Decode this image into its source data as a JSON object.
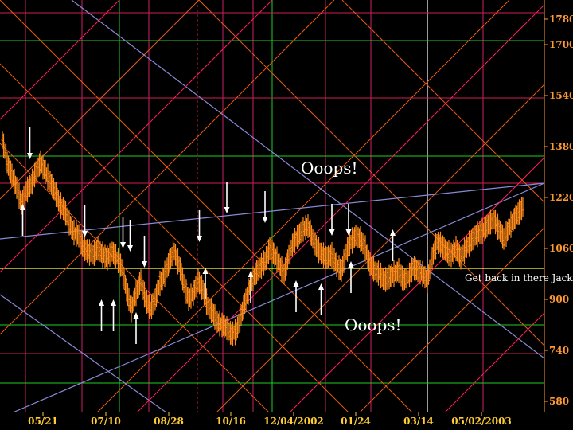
{
  "chart_data": {
    "type": "bar",
    "subtype": "ohlc-with-gann-square-overlay",
    "title": "",
    "xlabel": "",
    "ylabel": "",
    "ylim": [
      520,
      1800
    ],
    "grid": true,
    "y_ticks": [
      "1780",
      "1700",
      "1540",
      "1380",
      "1220",
      "1060",
      "900",
      "740",
      "580"
    ],
    "x_ticks": [
      "05/21",
      "07/10",
      "08/28",
      "10/16",
      "12/04/2002",
      "01/24",
      "03/14",
      "05/02/2003"
    ],
    "annotations": [
      {
        "text": "Ooops!",
        "near": "upper-center",
        "size": "large"
      },
      {
        "text": "Ooops!",
        "near": "lower-center",
        "size": "large"
      },
      {
        "text": "Get back in there Jack!",
        "near": "right",
        "size": "small"
      }
    ],
    "colors": {
      "background": "#000000",
      "bars": "#ff8c1a",
      "axis_labels": "#ff9933",
      "date_labels": "#ffcc33",
      "vertical_grid_magenta": "#cc1f66",
      "vertical_grid_green": "#22cc22",
      "vertical_grid_white": "#ffffff",
      "horizontal_grid_magenta": "#cc1f55",
      "horizontal_grid_green": "#22cc22",
      "horizontal_yellow": "#ffff33",
      "diagonal_orange": "#e65c1a",
      "diagonal_blue": "#8a8ad6",
      "diagonal_red": "#ff2255",
      "arrows": "#ffffff"
    },
    "price_path": [
      [
        0,
        1400
      ],
      [
        4,
        1330
      ],
      [
        8,
        1290
      ],
      [
        12,
        1250
      ],
      [
        16,
        1200
      ],
      [
        20,
        1240
      ],
      [
        24,
        1260
      ],
      [
        28,
        1300
      ],
      [
        32,
        1330
      ],
      [
        36,
        1300
      ],
      [
        40,
        1270
      ],
      [
        44,
        1240
      ],
      [
        48,
        1200
      ],
      [
        52,
        1180
      ],
      [
        56,
        1140
      ],
      [
        60,
        1110
      ],
      [
        64,
        1100
      ],
      [
        68,
        1060
      ],
      [
        72,
        1050
      ],
      [
        76,
        1040
      ],
      [
        80,
        1060
      ],
      [
        84,
        1040
      ],
      [
        88,
        1030
      ],
      [
        92,
        1050
      ],
      [
        96,
        1030
      ],
      [
        100,
        1000
      ],
      [
        104,
        930
      ],
      [
        108,
        870
      ],
      [
        112,
        920
      ],
      [
        116,
        960
      ],
      [
        120,
        900
      ],
      [
        124,
        870
      ],
      [
        128,
        900
      ],
      [
        132,
        950
      ],
      [
        136,
        980
      ],
      [
        140,
        1020
      ],
      [
        144,
        1050
      ],
      [
        148,
        1010
      ],
      [
        152,
        950
      ],
      [
        156,
        900
      ],
      [
        160,
        920
      ],
      [
        164,
        960
      ],
      [
        168,
        930
      ],
      [
        172,
        880
      ],
      [
        176,
        860
      ],
      [
        180,
        830
      ],
      [
        184,
        820
      ],
      [
        188,
        810
      ],
      [
        192,
        790
      ],
      [
        196,
        800
      ],
      [
        200,
        850
      ],
      [
        204,
        900
      ],
      [
        208,
        950
      ],
      [
        212,
        980
      ],
      [
        216,
        1000
      ],
      [
        220,
        1020
      ],
      [
        224,
        1060
      ],
      [
        228,
        1040
      ],
      [
        232,
        1010
      ],
      [
        236,
        980
      ],
      [
        240,
        1040
      ],
      [
        244,
        1080
      ],
      [
        248,
        1100
      ],
      [
        252,
        1120
      ],
      [
        256,
        1130
      ],
      [
        260,
        1090
      ],
      [
        264,
        1060
      ],
      [
        268,
        1040
      ],
      [
        272,
        1030
      ],
      [
        276,
        1040
      ],
      [
        280,
        1010
      ],
      [
        284,
        990
      ],
      [
        288,
        1050
      ],
      [
        292,
        1080
      ],
      [
        296,
        1100
      ],
      [
        300,
        1090
      ],
      [
        304,
        1060
      ],
      [
        308,
        1010
      ],
      [
        312,
        990
      ],
      [
        316,
        980
      ],
      [
        320,
        960
      ],
      [
        324,
        970
      ],
      [
        328,
        980
      ],
      [
        332,
        990
      ],
      [
        336,
        960
      ],
      [
        340,
        970
      ],
      [
        344,
        1000
      ],
      [
        348,
        990
      ],
      [
        352,
        980
      ],
      [
        356,
        960
      ],
      [
        360,
        1030
      ],
      [
        364,
        1080
      ],
      [
        368,
        1070
      ],
      [
        372,
        1050
      ],
      [
        376,
        1040
      ],
      [
        380,
        1060
      ],
      [
        384,
        1030
      ],
      [
        388,
        1060
      ],
      [
        392,
        1080
      ],
      [
        396,
        1100
      ],
      [
        400,
        1110
      ],
      [
        404,
        1120
      ],
      [
        408,
        1140
      ],
      [
        412,
        1150
      ],
      [
        416,
        1120
      ],
      [
        420,
        1090
      ],
      [
        424,
        1120
      ],
      [
        428,
        1150
      ],
      [
        432,
        1170
      ],
      [
        436,
        1190
      ]
    ],
    "arrows": [
      {
        "bar": 23,
        "dir": "down",
        "target": 1340
      },
      {
        "bar": 17,
        "dir": "up",
        "target": 1200
      },
      {
        "bar": 69,
        "dir": "down",
        "target": 1095
      },
      {
        "bar": 83,
        "dir": "up",
        "target": 900
      },
      {
        "bar": 93,
        "dir": "up",
        "target": 900
      },
      {
        "bar": 101,
        "dir": "down",
        "target": 1060
      },
      {
        "bar": 107,
        "dir": "down",
        "target": 1050
      },
      {
        "bar": 112,
        "dir": "up",
        "target": 860
      },
      {
        "bar": 119,
        "dir": "down",
        "target": 1000
      },
      {
        "bar": 165,
        "dir": "down",
        "target": 1080
      },
      {
        "bar": 170,
        "dir": "up",
        "target": 1000
      },
      {
        "bar": 188,
        "dir": "down",
        "target": 1170
      },
      {
        "bar": 208,
        "dir": "up",
        "target": 990
      },
      {
        "bar": 220,
        "dir": "down",
        "target": 1140
      },
      {
        "bar": 246,
        "dir": "up",
        "target": 960
      },
      {
        "bar": 267,
        "dir": "up",
        "target": 950
      },
      {
        "bar": 276,
        "dir": "down",
        "target": 1100
      },
      {
        "bar": 290,
        "dir": "down",
        "target": 1100
      },
      {
        "bar": 292,
        "dir": "up",
        "target": 1020
      },
      {
        "bar": 327,
        "dir": "up",
        "target": 1120
      }
    ]
  }
}
